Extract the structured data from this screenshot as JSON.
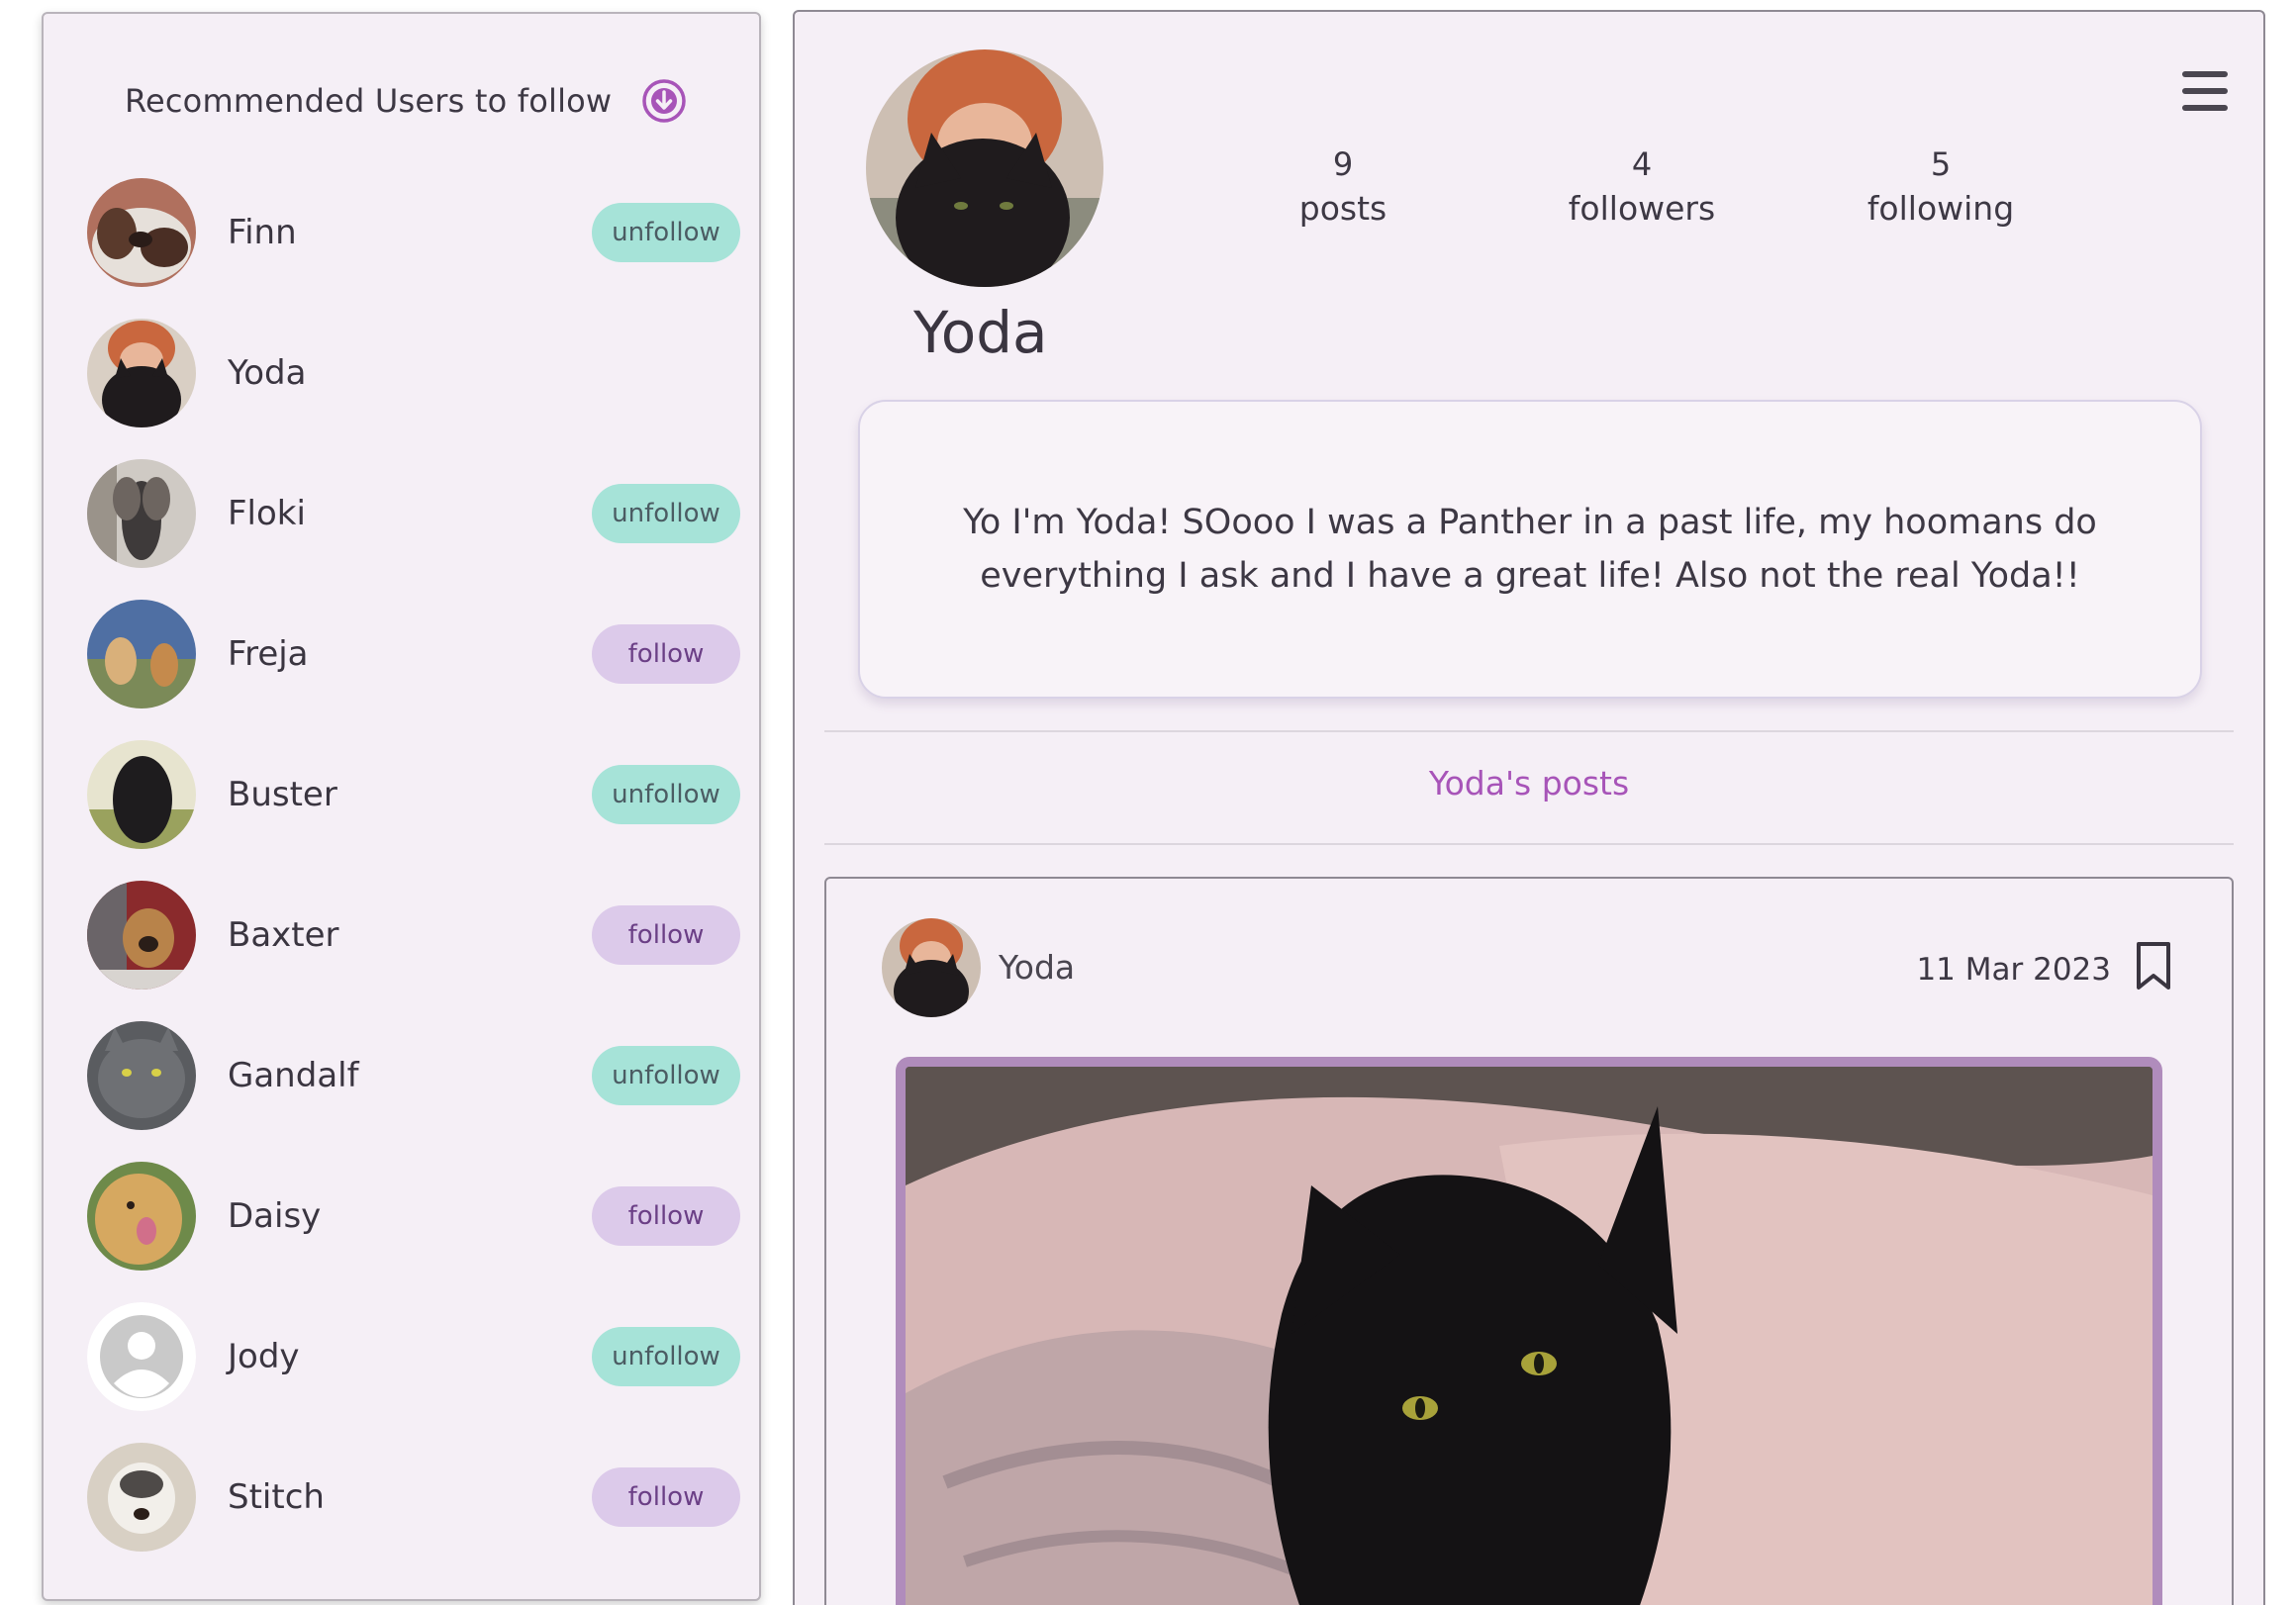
{
  "sidebar": {
    "title": "Recommended Users to follow",
    "toggle_icon": "arrow-circle-down-icon",
    "users": [
      {
        "name": "Finn",
        "action": "unfollow"
      },
      {
        "name": "Yoda",
        "action": ""
      },
      {
        "name": "Floki",
        "action": "unfollow"
      },
      {
        "name": "Freja",
        "action": "follow"
      },
      {
        "name": "Buster",
        "action": "unfollow"
      },
      {
        "name": "Baxter",
        "action": "follow"
      },
      {
        "name": "Gandalf",
        "action": "unfollow"
      },
      {
        "name": "Daisy",
        "action": "follow"
      },
      {
        "name": "Jody",
        "action": "unfollow"
      },
      {
        "name": "Stitch",
        "action": "follow"
      }
    ]
  },
  "profile": {
    "name": "Yoda",
    "stats": {
      "posts_count": "9",
      "posts_label": "posts",
      "followers_count": "4",
      "followers_label": "followers",
      "following_count": "5",
      "following_label": "following"
    },
    "bio": "Yo I'm Yoda! SOooo I was a Panther in a past life, my hoomans do everything I ask and I have a great life! Also not the real Yoda!!",
    "menu_icon": "hamburger-menu-icon"
  },
  "posts_section": {
    "heading": "Yoda's posts",
    "post": {
      "author": "Yoda",
      "date": "11 Mar 2023",
      "bookmark_icon": "bookmark-icon"
    }
  },
  "colors": {
    "panel_bg": "#f5eff6",
    "follow_pill": "#dccaea",
    "unfollow_pill": "#a6e3d8",
    "accent_purple": "#a754b8",
    "image_border": "#b08cbc"
  }
}
